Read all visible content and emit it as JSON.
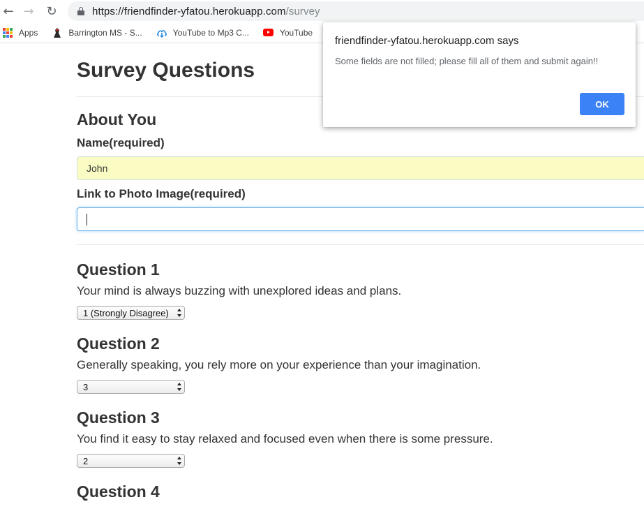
{
  "browser": {
    "url_host": "https://friendfinder-yfatou.herokuapp.com",
    "url_path": "/survey",
    "bookmarks": [
      {
        "label": "Apps",
        "icon": "apps-grid-icon"
      },
      {
        "label": "Barrington MS - S...",
        "icon": "school-logo-icon"
      },
      {
        "label": "YouTube to Mp3 C...",
        "icon": "cloud-download-icon"
      },
      {
        "label": "YouTube",
        "icon": "youtube-icon"
      }
    ]
  },
  "page": {
    "title": "Survey Questions",
    "about_heading": "About You",
    "name_label": "Name(required)",
    "name_value": "John",
    "photo_label": "Link to Photo Image(required)",
    "photo_value": "",
    "questions": [
      {
        "heading": "Question 1",
        "text": "Your mind is always buzzing with unexplored ideas and plans.",
        "selected": "1 (Strongly Disagree)"
      },
      {
        "heading": "Question 2",
        "text": "Generally speaking, you rely more on your experience than your imagination.",
        "selected": "3"
      },
      {
        "heading": "Question 3",
        "text": "You find it easy to stay relaxed and focused even when there is some pressure.",
        "selected": "2"
      },
      {
        "heading": "Question 4"
      }
    ]
  },
  "dialog": {
    "title": "friendfinder-yfatou.herokuapp.com says",
    "message": "Some fields are not filled; please fill all of them and submit again!!",
    "ok_label": "OK"
  },
  "colors": {
    "autofill_bg": "#fafcc3",
    "focus_border": "#66afe9",
    "ok_button": "#3b82f6",
    "youtube_red": "#ff0000"
  }
}
